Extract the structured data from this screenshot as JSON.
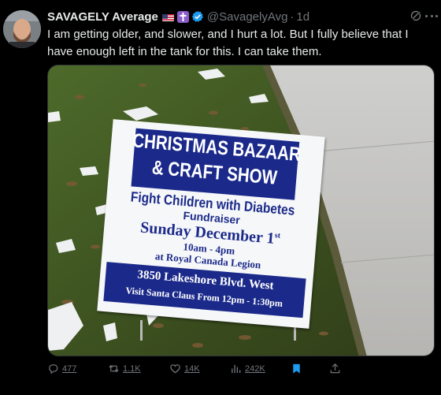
{
  "author": {
    "name": "SAVAGELY Average",
    "handle": "@SavagelyAvg",
    "time": "1d"
  },
  "tweet_text": "I am getting older, and slower, and I hurt a lot.  But I fully believe that I have enough left in the tank for this.  I can take them.",
  "sign": {
    "title_line1": "CHRISTMAS BAZAAR",
    "title_line2": "& CRAFT SHOW",
    "cause": "Fight Children with Diabetes",
    "event_type": "Fundraiser",
    "date": "Sunday December 1",
    "date_suffix": "st",
    "hours": "10am - 4pm",
    "venue": "at Royal Canada Legion",
    "address": "3850 Lakeshore Blvd. West",
    "santa": "Visit Santa Claus From 12pm - 1:30pm"
  },
  "actions": {
    "replies": "477",
    "reposts": "1.1K",
    "likes": "14K",
    "views": "242K"
  },
  "colors": {
    "background": "#000000",
    "text": "#e7e9ea",
    "muted": "#71767b",
    "accent": "#1d9bf0",
    "sign_blue": "#1b2a8a"
  },
  "icons": [
    "us-flag-icon",
    "cross-icon",
    "verified-badge-icon",
    "grok-icon",
    "more-icon",
    "reply-icon",
    "repost-icon",
    "like-icon",
    "views-icon",
    "bookmark-icon",
    "share-icon"
  ]
}
